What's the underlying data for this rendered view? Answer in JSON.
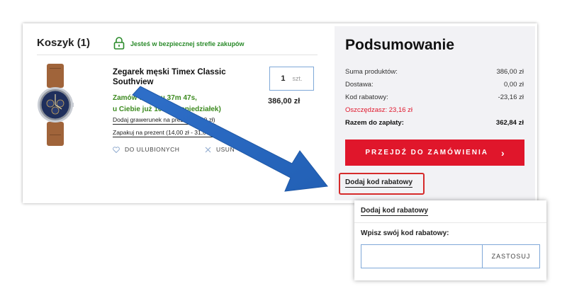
{
  "cart": {
    "title": "Koszyk (1)",
    "secure_text": "Jesteś w bezpiecznej strefie zakupów"
  },
  "product": {
    "name": "Zegarek męski Timex Classic Southview",
    "delivery_line1": "Zamów w ciągu 37m 47s,",
    "delivery_line2": "u Ciebie już 10.10 (poniedziałek)",
    "engrave_link": "Dodaj grawerunek na prezent (0,00 zł)",
    "gift_link": "Zapakuj na prezent (14,00 zł - 31,00 zł)",
    "favorite_label": "DO ULUBIONYCH",
    "remove_label": "USUŃ",
    "quantity": "1",
    "quantity_unit": "szt.",
    "price": "386,00 zł",
    "image_icon": "wristwatch-icon"
  },
  "summary": {
    "title": "Podsumowanie",
    "rows": [
      {
        "label": "Suma produktów:",
        "value": "386,00 zł"
      },
      {
        "label": "Dostawa:",
        "value": "0,00 zł"
      },
      {
        "label": "Kod rabatowy:",
        "value": "-23,16 zł"
      }
    ],
    "saving": "Oszczędzasz: 23,16 zł",
    "total_label": "Razem do zapłaty:",
    "total_value": "362,84 zł",
    "checkout_label": "PRZEJDŹ DO ZAMÓWIENIA",
    "checkout_chevron": "›",
    "discount_link": "Dodaj kod rabatowy"
  },
  "popup": {
    "link": "Dodaj kod rabatowy",
    "label": "Wpisz swój kod rabatowy:",
    "input_value": "",
    "input_placeholder": "",
    "apply_label": "ZASTOSUJ"
  },
  "colors": {
    "accent_red": "#e0162b",
    "highlight_red": "#d62b2b",
    "delivery_green": "#3c8a1f",
    "arrow_blue": "#2c6bc4",
    "summary_bg": "#f2f2f5"
  }
}
